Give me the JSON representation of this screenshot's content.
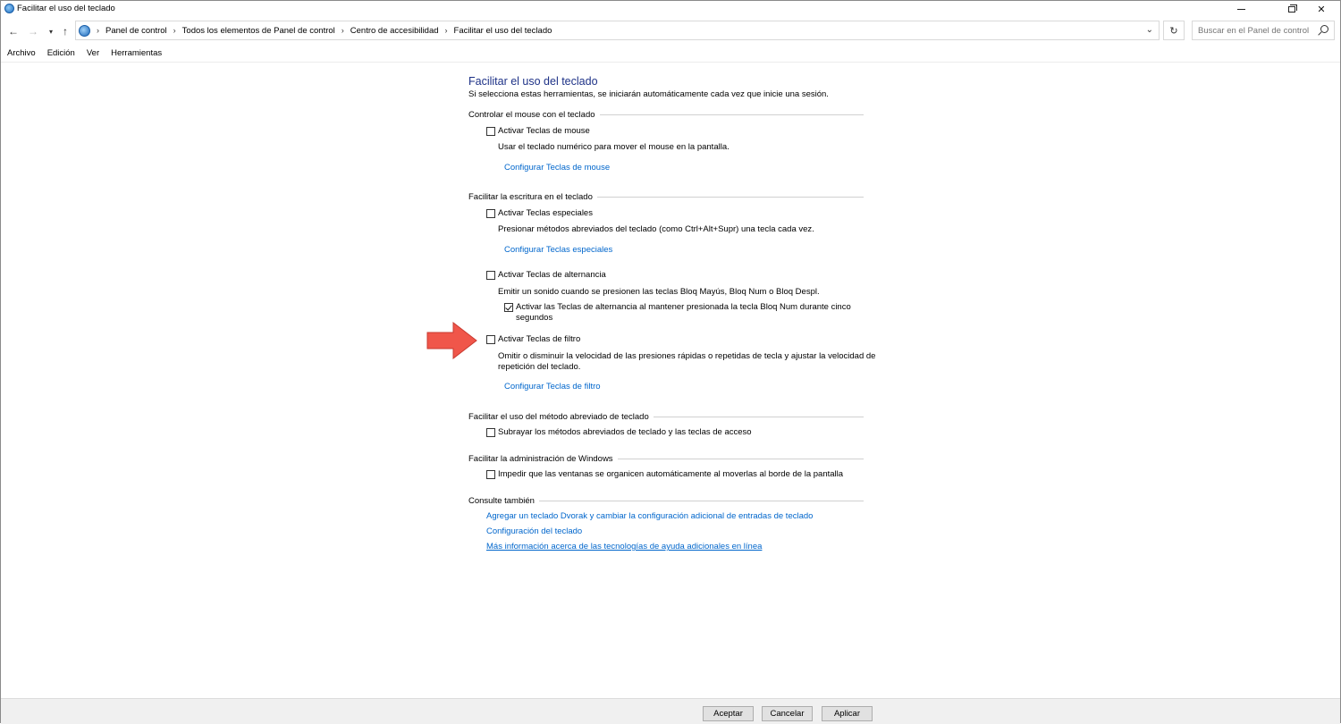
{
  "window": {
    "title": "Facilitar el uso del teclado"
  },
  "address_bar": {
    "breadcrumbs": [
      "Panel de control",
      "Todos los elementos de Panel de control",
      "Centro de accesibilidad",
      "Facilitar el uso del teclado"
    ],
    "search_placeholder": "Buscar en el Panel de control"
  },
  "menu": [
    "Archivo",
    "Edición",
    "Ver",
    "Herramientas"
  ],
  "page": {
    "title": "Facilitar el uso del teclado",
    "subtitle": "Si selecciona estas herramientas, se iniciarán automáticamente cada vez que inicie una sesión."
  },
  "sections": {
    "mouse": {
      "heading": "Controlar el mouse con el teclado",
      "option": {
        "label": "Activar Teclas de mouse",
        "checked": false
      },
      "description": "Usar el teclado numérico para mover el mouse en la pantalla.",
      "link": "Configurar Teclas de mouse"
    },
    "typing": {
      "heading": "Facilitar la escritura en el teclado",
      "sticky": {
        "label": "Activar Teclas especiales",
        "checked": false,
        "description": "Presionar métodos abreviados del teclado (como Ctrl+Alt+Supr) una tecla cada vez.",
        "link": "Configurar Teclas especiales"
      },
      "toggle": {
        "label": "Activar Teclas de alternancia",
        "checked": false,
        "description": "Emitir un sonido cuando se presionen las teclas Bloq Mayús, Bloq Num o Bloq Despl.",
        "sub_option": {
          "label_line1": "Activar las Teclas de alternancia al mantener presionada la tecla Bloq Num durante cinco",
          "label_line2": "segundos",
          "checked": true
        }
      },
      "filter": {
        "label": "Activar Teclas de filtro",
        "checked": false,
        "description_line1": "Omitir o disminuir la velocidad de las presiones rápidas o repetidas de tecla y ajustar la velocidad de",
        "description_line2": "repetición del teclado.",
        "link": "Configurar Teclas de filtro"
      }
    },
    "shortcuts": {
      "heading": "Facilitar el uso del método abreviado de teclado",
      "option": {
        "label": "Subrayar los métodos abreviados de teclado y las teclas de acceso",
        "checked": false
      }
    },
    "windows": {
      "heading": "Facilitar la administración de Windows",
      "option": {
        "label": "Impedir que las ventanas se organicen automáticamente al moverlas al borde de la pantalla",
        "checked": false
      }
    },
    "see_also": {
      "heading": "Consulte también",
      "links": [
        "Agregar un teclado Dvorak y cambiar la configuración adicional de entradas de teclado",
        "Configuración del teclado",
        "Más información acerca de las tecnologías de ayuda adicionales en línea"
      ]
    }
  },
  "buttons": {
    "ok": "Aceptar",
    "cancel": "Cancelar",
    "apply": "Aplicar"
  },
  "colors": {
    "title": "#1e3287",
    "link": "#0066cc",
    "arrow": "#f0564a"
  },
  "icons": [
    "control-panel-icon",
    "back-arrow-icon",
    "forward-arrow-icon",
    "up-arrow-icon",
    "refresh-icon",
    "search-icon",
    "red-pointer-arrow-icon"
  ]
}
